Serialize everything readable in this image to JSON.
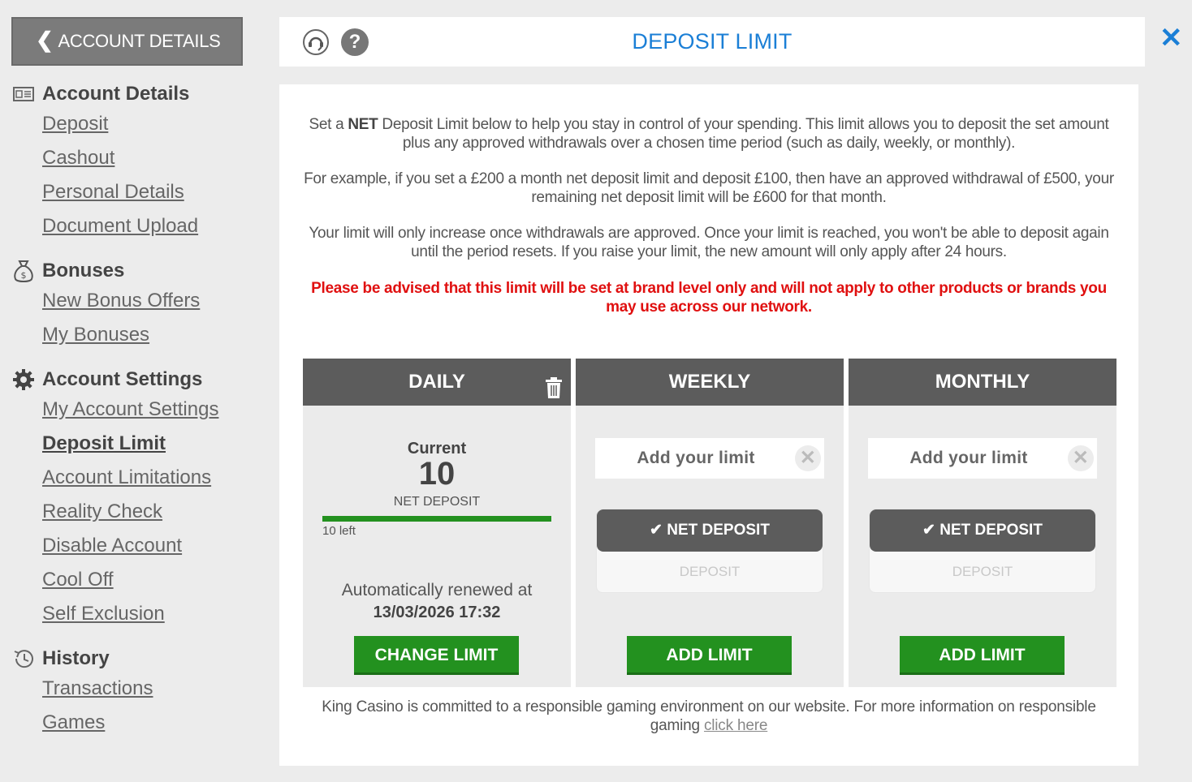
{
  "sidebar": {
    "back_label": "ACCOUNT DETAILS",
    "groups": [
      {
        "title": "Account Details",
        "items": [
          "Deposit",
          "Cashout",
          "Personal Details",
          "Document Upload"
        ]
      },
      {
        "title": "Bonuses",
        "items": [
          "New Bonus Offers",
          "My Bonuses"
        ]
      },
      {
        "title": "Account Settings",
        "items": [
          "My Account Settings",
          "Deposit Limit",
          "Account Limitations",
          "Reality Check",
          "Disable Account",
          "Cool Off",
          "Self Exclusion"
        ]
      },
      {
        "title": "History",
        "items": [
          "Transactions",
          "Games"
        ]
      }
    ],
    "active_item": "Deposit Limit"
  },
  "header": {
    "title": "DEPOSIT LIMIT",
    "close_icon": "close-icon"
  },
  "info": {
    "p1_a": "Set a ",
    "p1_bold": "NET",
    "p1_b": " Deposit Limit below to help you stay in control of your spending. This limit allows you to deposit the set amount plus any approved withdrawals over a chosen time period (such as daily, weekly, or monthly).",
    "p2": "For example, if you set a £200 a month net deposit limit and deposit £100, then have an approved withdrawal of £500, your remaining net deposit limit will be £600 for that month.",
    "p3": "Your limit will only increase once withdrawals are approved. Once your limit is reached, you won't be able to deposit again until the period resets. If you raise your limit, the new amount will only apply after 24 hours.",
    "warning": "Please be advised that this limit will be set at brand level only and will not apply to other products or brands you may use across our network."
  },
  "cards": {
    "daily": {
      "title": "DAILY",
      "current_label": "Current",
      "current_value": "10",
      "type_label": "NET DEPOSIT",
      "remaining": "10 left",
      "remaining_fraction": 1.0,
      "renew_label": "Automatically renewed at",
      "renew_date": "13/03/2026 17:32",
      "button": "CHANGE LIMIT"
    },
    "weekly": {
      "title": "WEEKLY",
      "placeholder": "Add your limit",
      "net_label": "NET DEPOSIT",
      "deposit_label": "DEPOSIT",
      "button": "ADD LIMIT"
    },
    "monthly": {
      "title": "MONTHLY",
      "placeholder": "Add your limit",
      "net_label": "NET DEPOSIT",
      "deposit_label": "DEPOSIT",
      "button": "ADD LIMIT"
    }
  },
  "footer": {
    "text": "King Casino is committed to a responsible gaming environment on our website. For more information on responsible gaming ",
    "link": "click here"
  },
  "colors": {
    "accent_blue": "#1b7fd6",
    "green": "#23911f",
    "warning_red": "#e01010",
    "dark_header": "#5c5c5c"
  }
}
